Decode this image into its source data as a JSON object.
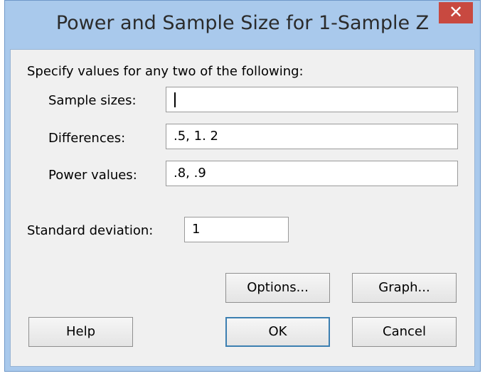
{
  "dialog": {
    "title": "Power and Sample Size for 1-Sample Z",
    "close_glyph": "✕"
  },
  "form": {
    "instruction": "Specify values for any two of the following:",
    "sample_sizes": {
      "label": "Sample sizes:",
      "value": ""
    },
    "differences": {
      "label": "Differences:",
      "value": ".5, 1. 2"
    },
    "power_values": {
      "label": "Power values:",
      "value": ".8, .9"
    },
    "std_dev": {
      "label": "Standard deviation:",
      "value": "1"
    }
  },
  "buttons": {
    "options": "Options...",
    "graph": "Graph...",
    "help": "Help",
    "ok": "OK",
    "cancel": "Cancel"
  }
}
